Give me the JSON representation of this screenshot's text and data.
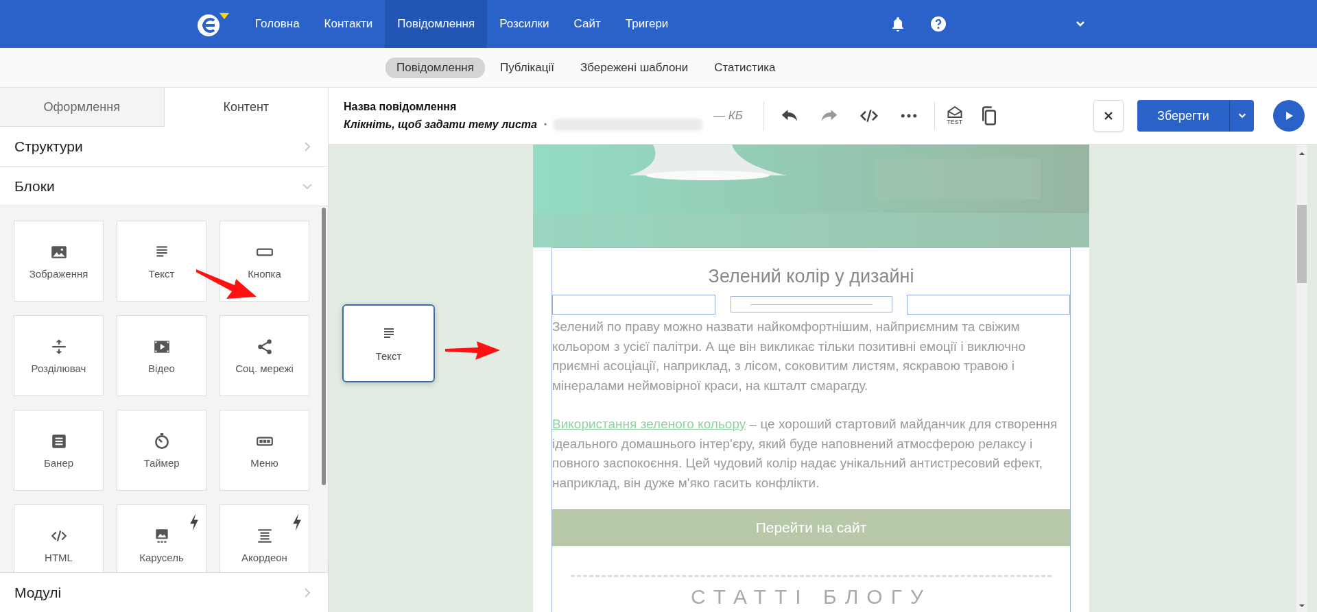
{
  "top_nav": {
    "items": [
      {
        "label": "Головна",
        "selected": false
      },
      {
        "label": "Контакти",
        "selected": false
      },
      {
        "label": "Повідомлення",
        "selected": true
      },
      {
        "label": "Розсилки",
        "selected": false
      },
      {
        "label": "Сайт",
        "selected": false
      },
      {
        "label": "Тригери",
        "selected": false
      }
    ]
  },
  "sub_nav": {
    "items": [
      {
        "label": "Повідомлення",
        "selected": true
      },
      {
        "label": "Публікації",
        "selected": false
      },
      {
        "label": "Збережені шаблони",
        "selected": false
      },
      {
        "label": "Статистика",
        "selected": false
      }
    ]
  },
  "sidebar": {
    "tabs": [
      {
        "label": "Оформлення",
        "selected": false
      },
      {
        "label": "Контент",
        "selected": true
      }
    ],
    "sections": [
      {
        "label": "Структури",
        "expanded": false
      },
      {
        "label": "Блоки",
        "expanded": true
      }
    ],
    "blocks": [
      {
        "label": "Зображення",
        "flash": false
      },
      {
        "label": "Текст",
        "flash": false
      },
      {
        "label": "Кнопка",
        "flash": false
      },
      {
        "label": "Розділювач",
        "flash": false
      },
      {
        "label": "Відео",
        "flash": false
      },
      {
        "label": "Соц. мережі",
        "flash": false
      },
      {
        "label": "Банер",
        "flash": false
      },
      {
        "label": "Таймер",
        "flash": false
      },
      {
        "label": "Меню",
        "flash": false
      },
      {
        "label": "HTML",
        "flash": false
      },
      {
        "label": "Карусель",
        "flash": true
      },
      {
        "label": "Акордеон",
        "flash": true
      }
    ],
    "footer_section": {
      "label": "Модулі",
      "expanded": false
    }
  },
  "toolbar": {
    "message_name": "Назва повідомлення",
    "subject_hint": "Клікніть, щоб задати тему листа",
    "separator": "•",
    "size": "— КБ",
    "test_label": "TEST",
    "save": "Зберегти"
  },
  "dragged_block": {
    "label": "Текст"
  },
  "email": {
    "title": "Зелений колір у дизайні",
    "paragraph_1": "Зелений по праву можно назвати найкомфортнішим, найприємним та свіжим кольором з усієї палітри. А ще він викликає тільки позитивні емоції і виключно приємні асоціації, наприклад, з лісом, соковитим листям, яскравою травою і мінералами неймовірної краси, на кшталт смарагду.",
    "link": "Використання зеленого кольору",
    "paragraph_2": " – це хороший стартовий майданчик для створення ідеального домашнього інтер'єру, який буде наповнений атмосферою релаксу і повного заспокоєння. Цей чудовий колір надає унікальний антистресовий ефект, наприклад, він дуже м'яко гасить конфлікти.",
    "button": "Перейти на сайт",
    "section_heading": "СТАТТІ БЛОГУ"
  }
}
